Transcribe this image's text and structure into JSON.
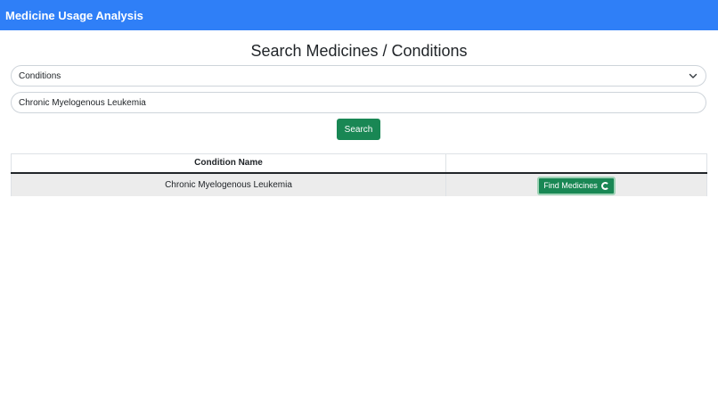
{
  "app": {
    "title": "Medicine Usage Analysis"
  },
  "search": {
    "heading": "Search Medicines / Conditions",
    "type_selected": "Conditions",
    "query_value": "Chronic Myelogenous Leukemia",
    "button_label": "Search"
  },
  "results": {
    "headers": [
      "Condition Name",
      ""
    ],
    "rows": [
      {
        "condition": "Chronic Myelogenous Leukemia",
        "action_label": "Find Medicines"
      }
    ]
  },
  "colors": {
    "navbar": "#2f7ff7",
    "primary_action": "#198754"
  }
}
